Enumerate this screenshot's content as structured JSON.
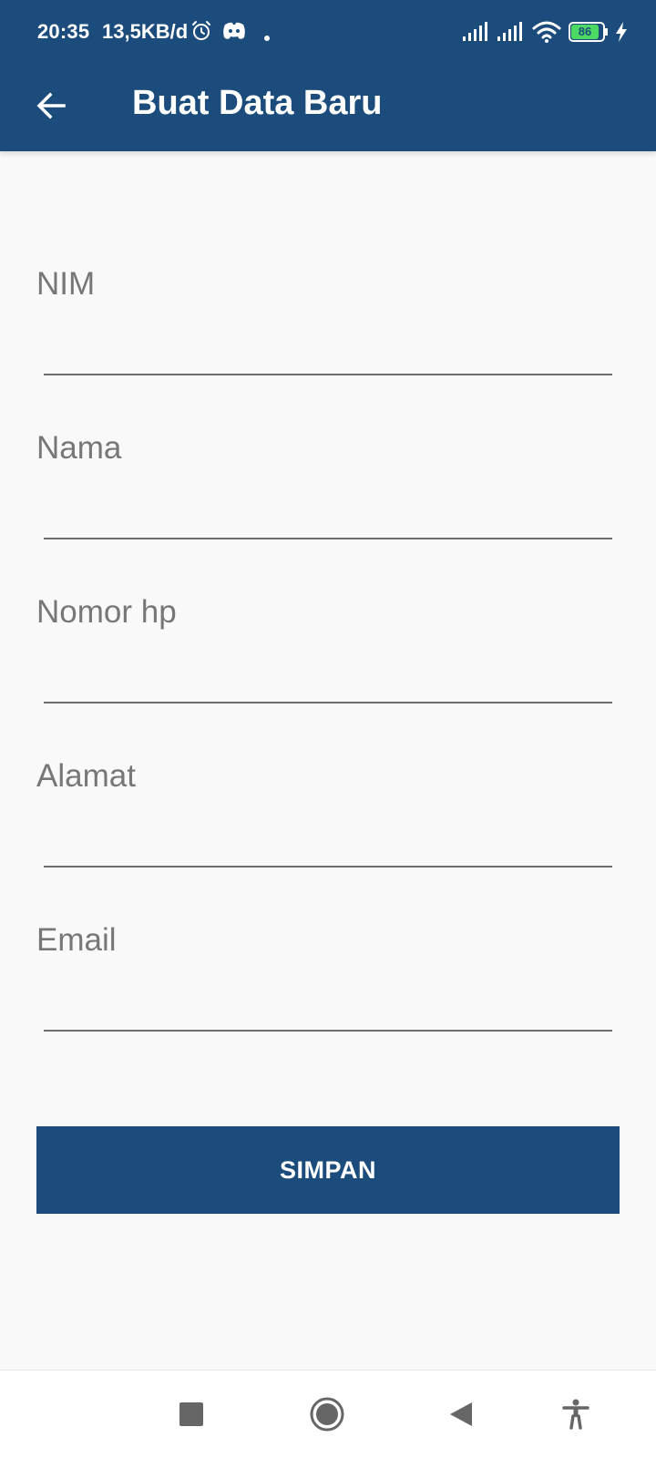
{
  "status_bar": {
    "time": "20:35",
    "net_speed": "13,5KB/d",
    "battery": "86",
    "icons": [
      "alarm-icon",
      "discord-icon",
      "notification-dot-icon",
      "signal-icon",
      "signal-icon",
      "wifi-icon",
      "battery-icon",
      "charging-icon"
    ]
  },
  "app_bar": {
    "title": "Buat Data Baru",
    "back_icon": "arrow-left-icon"
  },
  "form": {
    "fields": [
      {
        "label": "NIM",
        "value": ""
      },
      {
        "label": "Nama",
        "value": ""
      },
      {
        "label": "Nomor hp",
        "value": ""
      },
      {
        "label": "Alamat",
        "value": ""
      },
      {
        "label": "Email",
        "value": ""
      }
    ],
    "save_label": "SIMPAN"
  },
  "nav_bar": {
    "buttons": [
      "recents-icon",
      "home-icon",
      "back-icon",
      "accessibility-icon"
    ]
  },
  "colors": {
    "primary": "#1c4c7c",
    "background": "#f9f9fa",
    "label": "#777777",
    "underline": "#6e6e6e"
  }
}
